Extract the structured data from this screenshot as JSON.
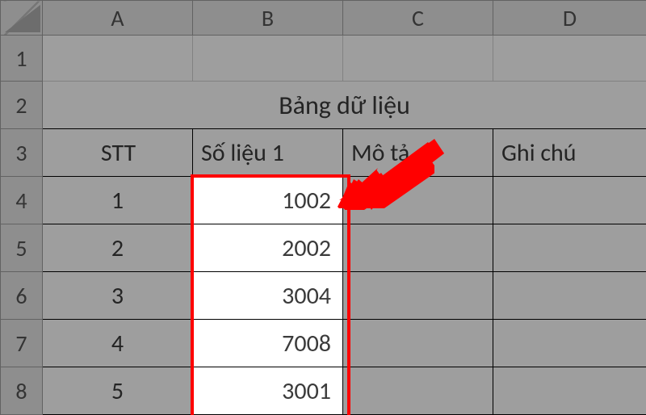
{
  "columns": [
    "A",
    "B",
    "C",
    "D"
  ],
  "row_numbers": [
    "1",
    "2",
    "3",
    "4",
    "5",
    "6",
    "7",
    "8"
  ],
  "table": {
    "title": "Bảng dữ liệu",
    "headers": {
      "stt": "STT",
      "soLieu1": "Số liệu 1",
      "moTa": "Mô tả",
      "ghiChu": "Ghi chú"
    },
    "rows": [
      {
        "stt": "1",
        "val": "1002"
      },
      {
        "stt": "2",
        "val": "2002"
      },
      {
        "stt": "3",
        "val": "3004"
      },
      {
        "stt": "4",
        "val": "7008"
      },
      {
        "stt": "5",
        "val": "3001"
      }
    ]
  },
  "highlight_range": "B4:B8"
}
